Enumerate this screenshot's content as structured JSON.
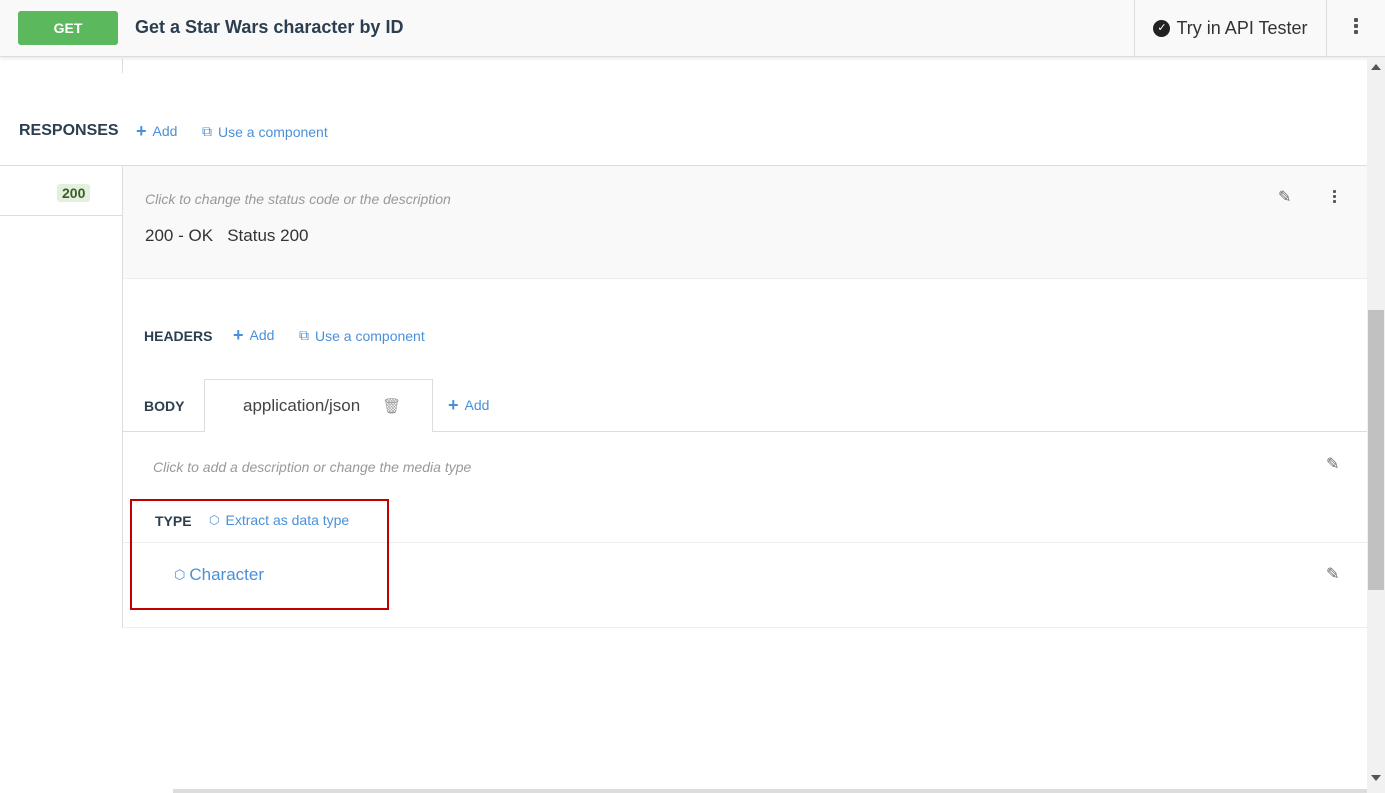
{
  "header": {
    "method": "GET",
    "title": "Get a Star Wars character by ID",
    "try_label": "Try in API Tester"
  },
  "responses": {
    "label": "RESPONSES",
    "add": "Add",
    "use_component": "Use a component",
    "status_code": "200",
    "hint": "Click to change the status code or the description",
    "summary": "200 - OK",
    "description": "Status 200"
  },
  "headers": {
    "label": "HEADERS",
    "add": "Add",
    "use_component": "Use a component"
  },
  "body": {
    "label": "BODY",
    "media_type": "application/json",
    "add": "Add",
    "hint": "Click to add a description or change the media type"
  },
  "type": {
    "label": "TYPE",
    "extract": "Extract as data type",
    "value": "Character"
  },
  "colors": {
    "accent": "#4a90d9",
    "get": "#5cb85c",
    "highlight": "#c00000"
  }
}
